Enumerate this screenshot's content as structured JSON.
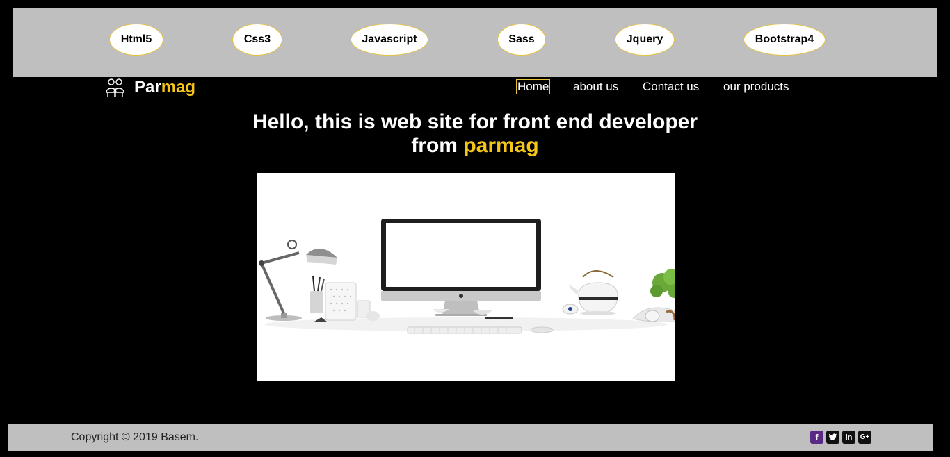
{
  "tech_bar": {
    "items": [
      "Html5",
      "Css3",
      "Javascript",
      "Sass",
      "Jquery",
      "Bootstrap4"
    ]
  },
  "header": {
    "brand_part1": "Par",
    "brand_part2": "mag",
    "nav": [
      "Home",
      "about us",
      "Contact us",
      "our products"
    ],
    "active_nav": "Home"
  },
  "hero": {
    "line1": "Hello, this is web site for front end developer",
    "line2_prefix": "from",
    "line2_highlight": "parmag"
  },
  "footer": {
    "copyright": "Copyright © 2019 Basem.",
    "social_icons": [
      "facebook-icon",
      "twitter-icon",
      "linkedin-icon",
      "google-plus-icon"
    ]
  },
  "colors": {
    "accent": "#f5c518",
    "bar_gray": "#bfbfbf",
    "background": "#000000",
    "facebook": "#5b2a86"
  }
}
